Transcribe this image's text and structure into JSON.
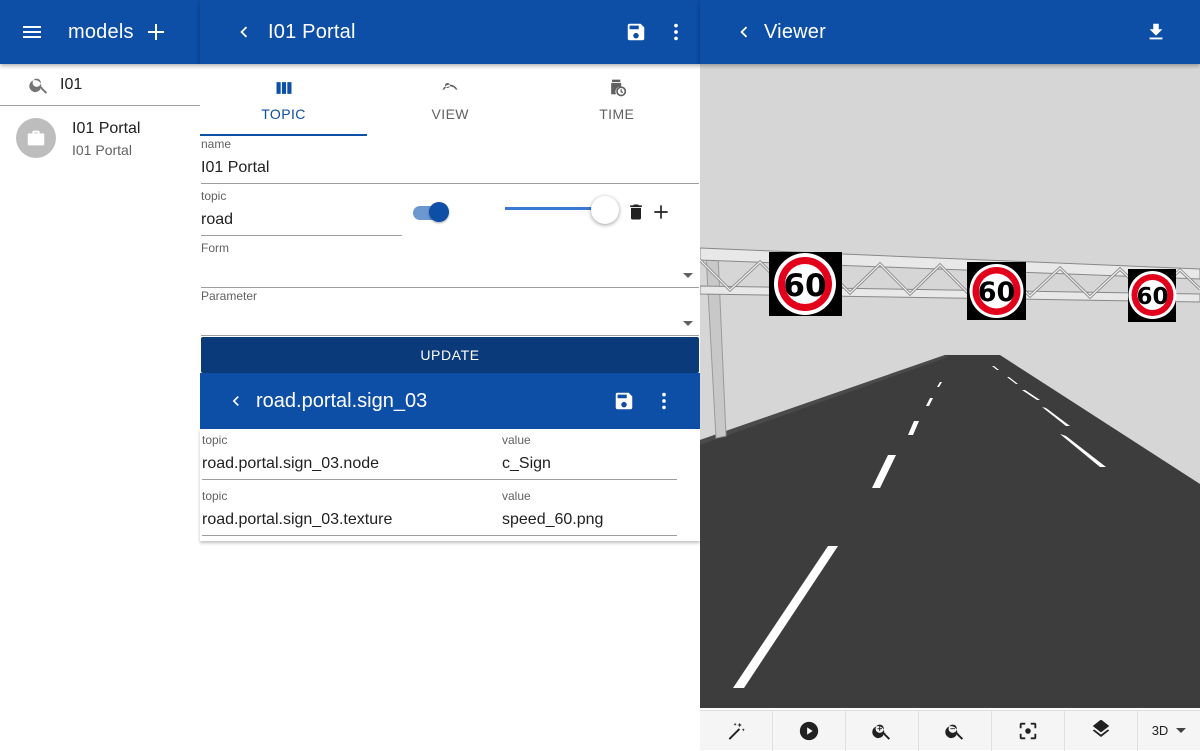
{
  "left": {
    "title": "models",
    "search_value": "I01",
    "items": [
      {
        "title": "I01 Portal",
        "subtitle": "I01 Portal"
      }
    ]
  },
  "middle": {
    "title": "I01 Portal",
    "tabs": [
      {
        "label": "TOPIC",
        "icon": "view-column-icon",
        "active": true
      },
      {
        "label": "VIEW",
        "icon": "visibility-icon",
        "active": false
      },
      {
        "label": "TIME",
        "icon": "history-icon",
        "active": false
      }
    ],
    "name_label": "name",
    "name_value": "I01 Portal",
    "topic_label": "topic",
    "topic_value": "road",
    "toggle_on": true,
    "slider_value": 1.0,
    "form_label": "Form",
    "form_value": "",
    "parameter_label": "Parameter",
    "parameter_value": "",
    "update_label": "UPDATE",
    "sub_title": "road.portal.sign_03",
    "rows": [
      {
        "topic_label": "topic",
        "topic": "road.portal.sign_03.node",
        "value_label": "value",
        "value": "c_Sign"
      },
      {
        "topic_label": "topic",
        "topic": "road.portal.sign_03.texture",
        "value_label": "value",
        "value": "speed_60.png"
      }
    ]
  },
  "right": {
    "title": "Viewer",
    "sign_text": "60",
    "mode": "3D",
    "toolbar_icons": [
      "magic-wand-icon",
      "play-icon",
      "zoom-in-icon",
      "zoom-out-icon",
      "center-focus-icon",
      "layers-icon"
    ]
  },
  "colors": {
    "primary": "#0d4ea6",
    "dark_primary": "#0a3a7a",
    "sign_red": "#e3001b"
  }
}
